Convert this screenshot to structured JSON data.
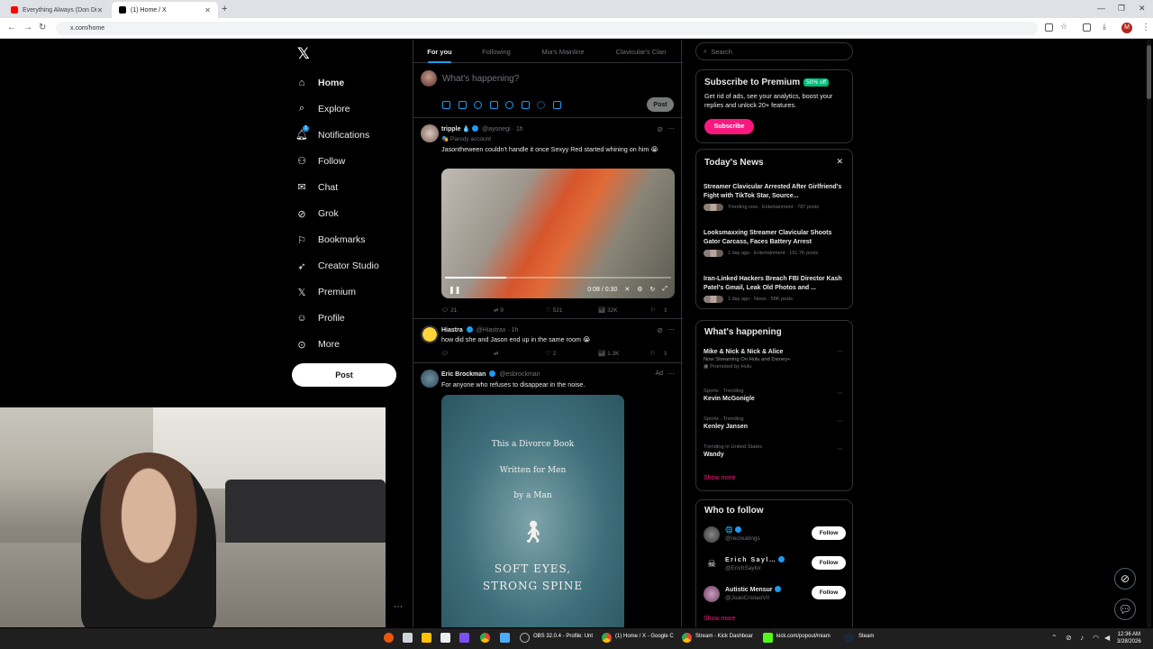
{
  "browser": {
    "tabs": [
      {
        "title": "Everything Always (Don Di",
        "favicon_color": "#ff0000"
      },
      {
        "title": "(1) Home / X",
        "favicon_color": "#000000"
      }
    ],
    "url": "x.com/home",
    "profile_initial": "M"
  },
  "sidebar": {
    "items": [
      {
        "label": "Home",
        "icon": "home-icon",
        "glyph": "⌂"
      },
      {
        "label": "Explore",
        "icon": "search-icon",
        "glyph": "⌕"
      },
      {
        "label": "Notifications",
        "icon": "bell-icon",
        "glyph": "♫",
        "badge": "1"
      },
      {
        "label": "Follow",
        "icon": "person-plus-icon",
        "glyph": "⚇"
      },
      {
        "label": "Chat",
        "icon": "mail-icon",
        "glyph": "✉"
      },
      {
        "label": "Grok",
        "icon": "grok-icon",
        "glyph": "⊘"
      },
      {
        "label": "Bookmarks",
        "icon": "bookmark-icon",
        "glyph": "⚐"
      },
      {
        "label": "Creator Studio",
        "icon": "rocket-icon",
        "glyph": "➶"
      },
      {
        "label": "Premium",
        "icon": "x-logo-icon",
        "glyph": "𝕏"
      },
      {
        "label": "Profile",
        "icon": "person-icon",
        "glyph": "☺"
      },
      {
        "label": "More",
        "icon": "more-circle-icon",
        "glyph": "⋯"
      }
    ],
    "post_label": "Post"
  },
  "feed": {
    "tabs": [
      "For you",
      "Following",
      "Mia's Mainline",
      "Clavicular's Clan"
    ],
    "compose_placeholder": "What's happening?",
    "compose_post": "Post",
    "tweets": [
      {
        "name": "tripple",
        "handle": "@ayonegi · 1h",
        "label": "Parody account",
        "text": "Jasontheween couldn't handle it once Sexyy Red started whining on him 😭",
        "video_time": "0:08 / 0:30",
        "video_progress": 0.27,
        "replies": "21",
        "reposts": "9",
        "likes": "521",
        "views": "32K"
      },
      {
        "name": "Hiastra",
        "handle": "@Hiastrax · 1h",
        "text": "how did she and Jason end up in the same room 😭",
        "replies": "",
        "reposts": "",
        "likes": "2",
        "views": "1.3K"
      },
      {
        "name": "Eric Brockman",
        "handle": "@esbrockman",
        "ad": "Ad",
        "text": "For anyone who refuses to disappear in the noise.",
        "book": {
          "line1": "This a Divorce Book",
          "line2": "Written for Men",
          "line3": "by a Man",
          "title1": "SOFT EYES,",
          "title2": "STRONG SPINE"
        }
      }
    ]
  },
  "right": {
    "search_placeholder": "Search",
    "premium": {
      "title": "Subscribe to Premium",
      "badge": "50% off",
      "body": "Get rid of ads, see your analytics, boost your replies and unlock 20+ features.",
      "button": "Subscribe"
    },
    "news": {
      "title": "Today's News",
      "items": [
        {
          "headline": "Streamer Clavicular Arrested After Girlfriend's Fight with TikTok Star, Source...",
          "meta": "Trending now · Entertainment · 787 posts"
        },
        {
          "headline": "Looksmaxxing Streamer Clavicular Shoots Gator Carcass, Faces Battery Arrest",
          "meta": "1 day ago · Entertainment · 191.7K posts"
        },
        {
          "headline": "Iran-Linked Hackers Breach FBI Director Kash Patel's Gmail, Leak Old Photos and ...",
          "meta": "1 day ago · News · 58K posts"
        }
      ]
    },
    "happening": {
      "title": "What's happening",
      "items": [
        {
          "category": "",
          "name": "Mike & Nick & Nick & Alice",
          "sub": "Now Streaming On Hulu and Disney+",
          "promo": "Promoted by Hulu"
        },
        {
          "category": "Sports · Trending",
          "name": "Kevin McGonigle"
        },
        {
          "category": "Sports · Trending",
          "name": "Kenley Jansen"
        },
        {
          "category": "Trending in United States",
          "name": "Wandy"
        }
      ],
      "show_more": "Show more"
    },
    "who_to_follow": {
      "title": "Who to follow",
      "accounts": [
        {
          "name": "🌐",
          "handle": "@recreatings",
          "button": "Follow"
        },
        {
          "name": "Erich Sayl…",
          "handle": "@ErichSaylor",
          "button": "Follow"
        },
        {
          "name": "Autistic Mensur",
          "handle": "@JoaoCristaoVII",
          "button": "Follow"
        }
      ],
      "show_more": "Show more"
    }
  },
  "taskbar": {
    "apps": [
      {
        "label": "OBS 32.0.4 - Profile: Unt"
      },
      {
        "label": "(1) Home / X - Google C"
      },
      {
        "label": "Stream - Kick Dashboar"
      },
      {
        "label": "kick.com/popout/miam"
      },
      {
        "label": "Steam"
      }
    ],
    "time": "12:36 AM",
    "date": "3/28/2026"
  }
}
